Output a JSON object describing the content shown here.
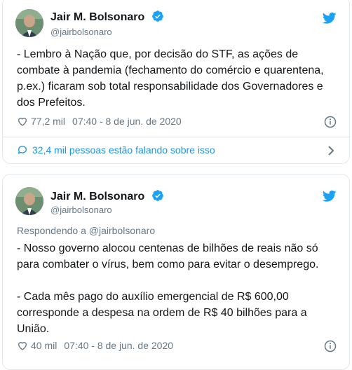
{
  "tweets": [
    {
      "author": {
        "name": "Jair M. Bolsonaro",
        "handle": "@jairbolsonaro"
      },
      "text": "- Lembro à Nação que, por decisão do STF, as ações de combate à pandemia (fechamento do comércio e quarentena, p.ex.) ficaram sob total responsabilidade dos Governadores e dos Prefeitos.",
      "likes": "77,2 mil",
      "timestamp": "07:40 - 8 de jun. de 2020",
      "conversation": "32,4 mil pessoas estão falando sobre isso"
    },
    {
      "author": {
        "name": "Jair M. Bolsonaro",
        "handle": "@jairbolsonaro"
      },
      "replying_to": "Respondendo a @jairbolsonaro",
      "text": "- Nosso governo alocou centenas de bilhões de reais não só para combater o vírus, bem como para evitar o desemprego.\n\n- Cada mês pago do auxílio emergencial de R$ 600,00 corresponde a despesa na ordem de R$ 40 bilhões para a União.",
      "likes": "40 mil",
      "timestamp": "07:40 - 8 de jun. de 2020"
    }
  ],
  "colors": {
    "accent": "#1da1f2",
    "link": "#1b95e0",
    "muted": "#657786",
    "border": "#e1e8ed"
  },
  "icons": [
    "avatar",
    "verified-badge-icon",
    "twitter-bird-icon",
    "heart-icon",
    "info-icon",
    "comment-icon",
    "chevron-right-icon"
  ]
}
